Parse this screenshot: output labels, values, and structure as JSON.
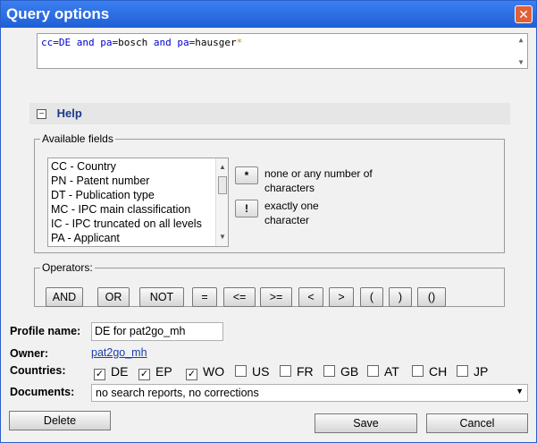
{
  "window": {
    "title": "Query options"
  },
  "query": {
    "tokens": [
      {
        "t": "cc",
        "k": "field"
      },
      {
        "t": "=",
        "k": "field"
      },
      {
        "t": "DE ",
        "k": "field"
      },
      {
        "t": "and ",
        "k": "op"
      },
      {
        "t": "pa",
        "k": "field"
      },
      {
        "t": "=",
        "k": "field"
      },
      {
        "t": "bosch ",
        "k": "val"
      },
      {
        "t": "and ",
        "k": "op"
      },
      {
        "t": "pa",
        "k": "field"
      },
      {
        "t": "=",
        "k": "field"
      },
      {
        "t": "hausger",
        "k": "val"
      },
      {
        "t": "*",
        "k": "wild"
      }
    ]
  },
  "help": {
    "label": "Help",
    "toggle": "−"
  },
  "available_fields": {
    "legend": "Available fields",
    "items": [
      "CC - Country",
      "PN - Patent number",
      "DT - Publication type",
      "MC - IPC main classification",
      "IC - IPC truncated on all levels",
      "PA - Applicant"
    ],
    "wildcards": [
      {
        "symbol": "*",
        "text": "none or any number of characters"
      },
      {
        "symbol": "!",
        "text": "exactly one character"
      }
    ]
  },
  "operators": {
    "legend": "Operators:",
    "buttons": [
      "AND",
      "OR",
      "NOT",
      "=",
      "<=",
      ">=",
      "<",
      ">",
      "(",
      ")",
      "()"
    ]
  },
  "profile": {
    "label": "Profile name:",
    "value": "DE for pat2go_mh"
  },
  "owner": {
    "label": "Owner:",
    "value": "pat2go_mh"
  },
  "countries": {
    "label": "Countries:",
    "items": [
      {
        "code": "DE",
        "checked": true
      },
      {
        "code": "EP",
        "checked": true
      },
      {
        "code": "WO",
        "checked": true
      },
      {
        "code": "US",
        "checked": false
      },
      {
        "code": "FR",
        "checked": false
      },
      {
        "code": "GB",
        "checked": false
      },
      {
        "code": "AT",
        "checked": false
      },
      {
        "code": "CH",
        "checked": false
      },
      {
        "code": "JP",
        "checked": false
      }
    ]
  },
  "documents": {
    "label": "Documents:",
    "value": "no search reports, no corrections"
  },
  "buttons": {
    "delete": "Delete",
    "save": "Save",
    "cancel": "Cancel"
  },
  "colors": {
    "title_bar": "#2b6ce6",
    "close": "#e0603a",
    "link": "#1a3fa8"
  }
}
